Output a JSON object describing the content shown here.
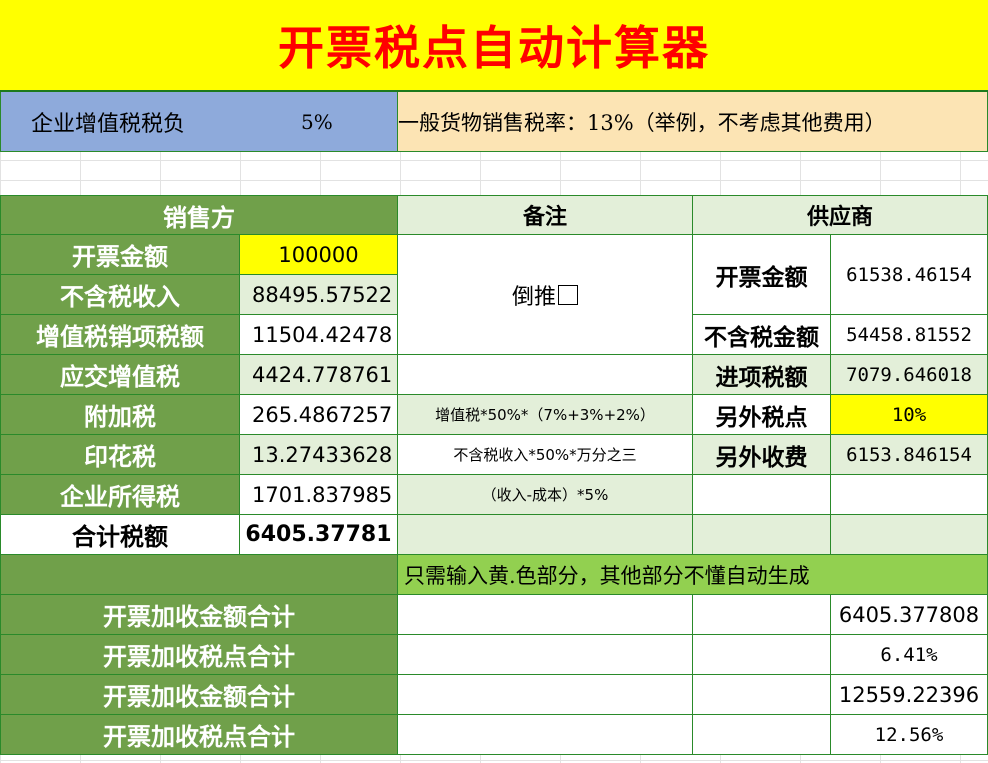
{
  "title": "开票税点自动计算器",
  "info_bar": {
    "burden_label": "企业增值税税负",
    "burden_value": "5%",
    "rate_note": "一般货物销售税率：13%（举例，不考虑其他费用）"
  },
  "headers": {
    "seller": "销售方",
    "remarks": "备注",
    "supplier": "供应商"
  },
  "seller_rows": [
    {
      "label": "开票金额",
      "value": "100000"
    },
    {
      "label": "不含税收入",
      "value": "88495.57522"
    },
    {
      "label": "增值税销项税额",
      "value": "11504.42478"
    },
    {
      "label": "应交增值税",
      "value": "4424.778761"
    },
    {
      "label": "附加税",
      "value": "265.4867257"
    },
    {
      "label": "印花税",
      "value": "13.27433628"
    },
    {
      "label": "企业所得税",
      "value": "1701.837985"
    }
  ],
  "total": {
    "label": "合计税额",
    "value": "6405.37781"
  },
  "remarks": {
    "reverse": "倒推",
    "surcharge": "增值税*50%*（7%+3%+2%）",
    "stamp": "不含税收入*50%*万分之三",
    "income": "（收入-成本）*5%"
  },
  "supplier_rows": [
    {
      "label": "开票金额",
      "value": "61538.46154"
    },
    {
      "label": "不含税金额",
      "value": "54458.81552"
    },
    {
      "label": "进项税额",
      "value": "7079.646018"
    },
    {
      "label": "另外税点",
      "value": "10%"
    },
    {
      "label": "另外收费",
      "value": "6153.846154"
    }
  ],
  "hint": "只需输入黄.色部分，其他部分不懂自动生成",
  "summary_rows": [
    {
      "label": "开票加收金额合计",
      "value": "6405.377808"
    },
    {
      "label": "开票加收税点合计",
      "value": "6.41%"
    },
    {
      "label": "开票加收金额合计",
      "value": "12559.22396"
    },
    {
      "label": "开票加收税点合计",
      "value": "12.56%"
    }
  ],
  "colors": {
    "title_bg": "#ffff00",
    "title_text": "#ff0000",
    "header_green": "#70a04a",
    "light_green": "#e3efd9",
    "blue": "#8eaadb",
    "peach": "#fce4b4",
    "hint_green": "#92d050"
  }
}
